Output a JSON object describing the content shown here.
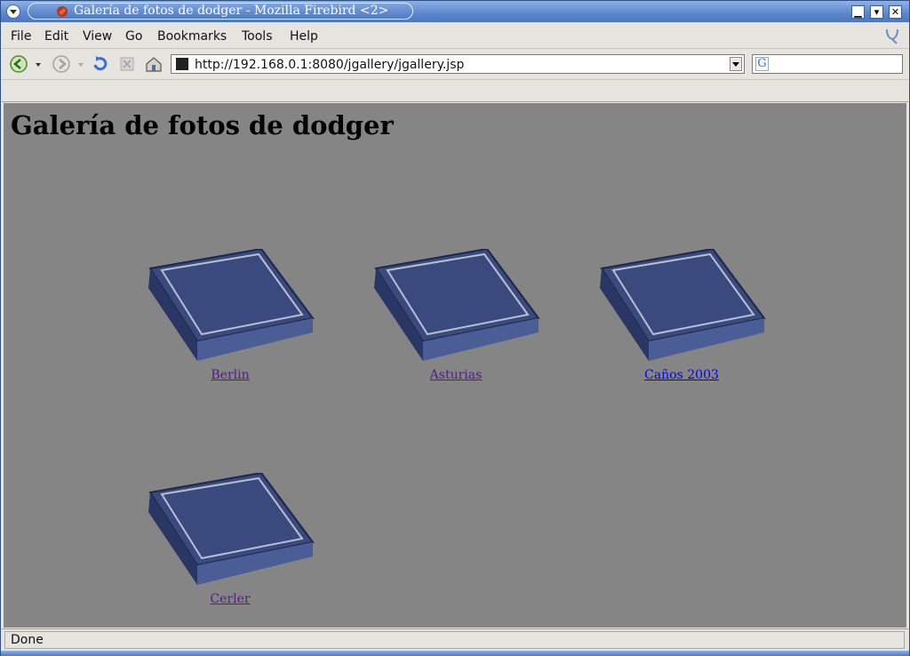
{
  "window": {
    "title": "Galería de fotos de dodger - Mozilla Firebird <2>"
  },
  "menubar": {
    "items": [
      "File",
      "Edit",
      "View",
      "Go",
      "Bookmarks",
      "Tools",
      "Help"
    ]
  },
  "navbar": {
    "url": "http://192.168.0.1:8080/jgallery/jgallery.jsp",
    "search_placeholder": ""
  },
  "page": {
    "heading": "Galería de fotos de dodger",
    "albums": [
      {
        "label": "Berlin",
        "visited": true
      },
      {
        "label": "Asturias",
        "visited": true
      },
      {
        "label": "Caños 2003",
        "visited": false
      },
      {
        "label": "Cerler",
        "visited": true
      }
    ]
  },
  "status": {
    "text": "Done"
  },
  "colors": {
    "content_bg": "#858585",
    "link_visited": "#551a8b",
    "link_unvisited": "#0000ee",
    "album_blue": "#3a4a7e"
  }
}
